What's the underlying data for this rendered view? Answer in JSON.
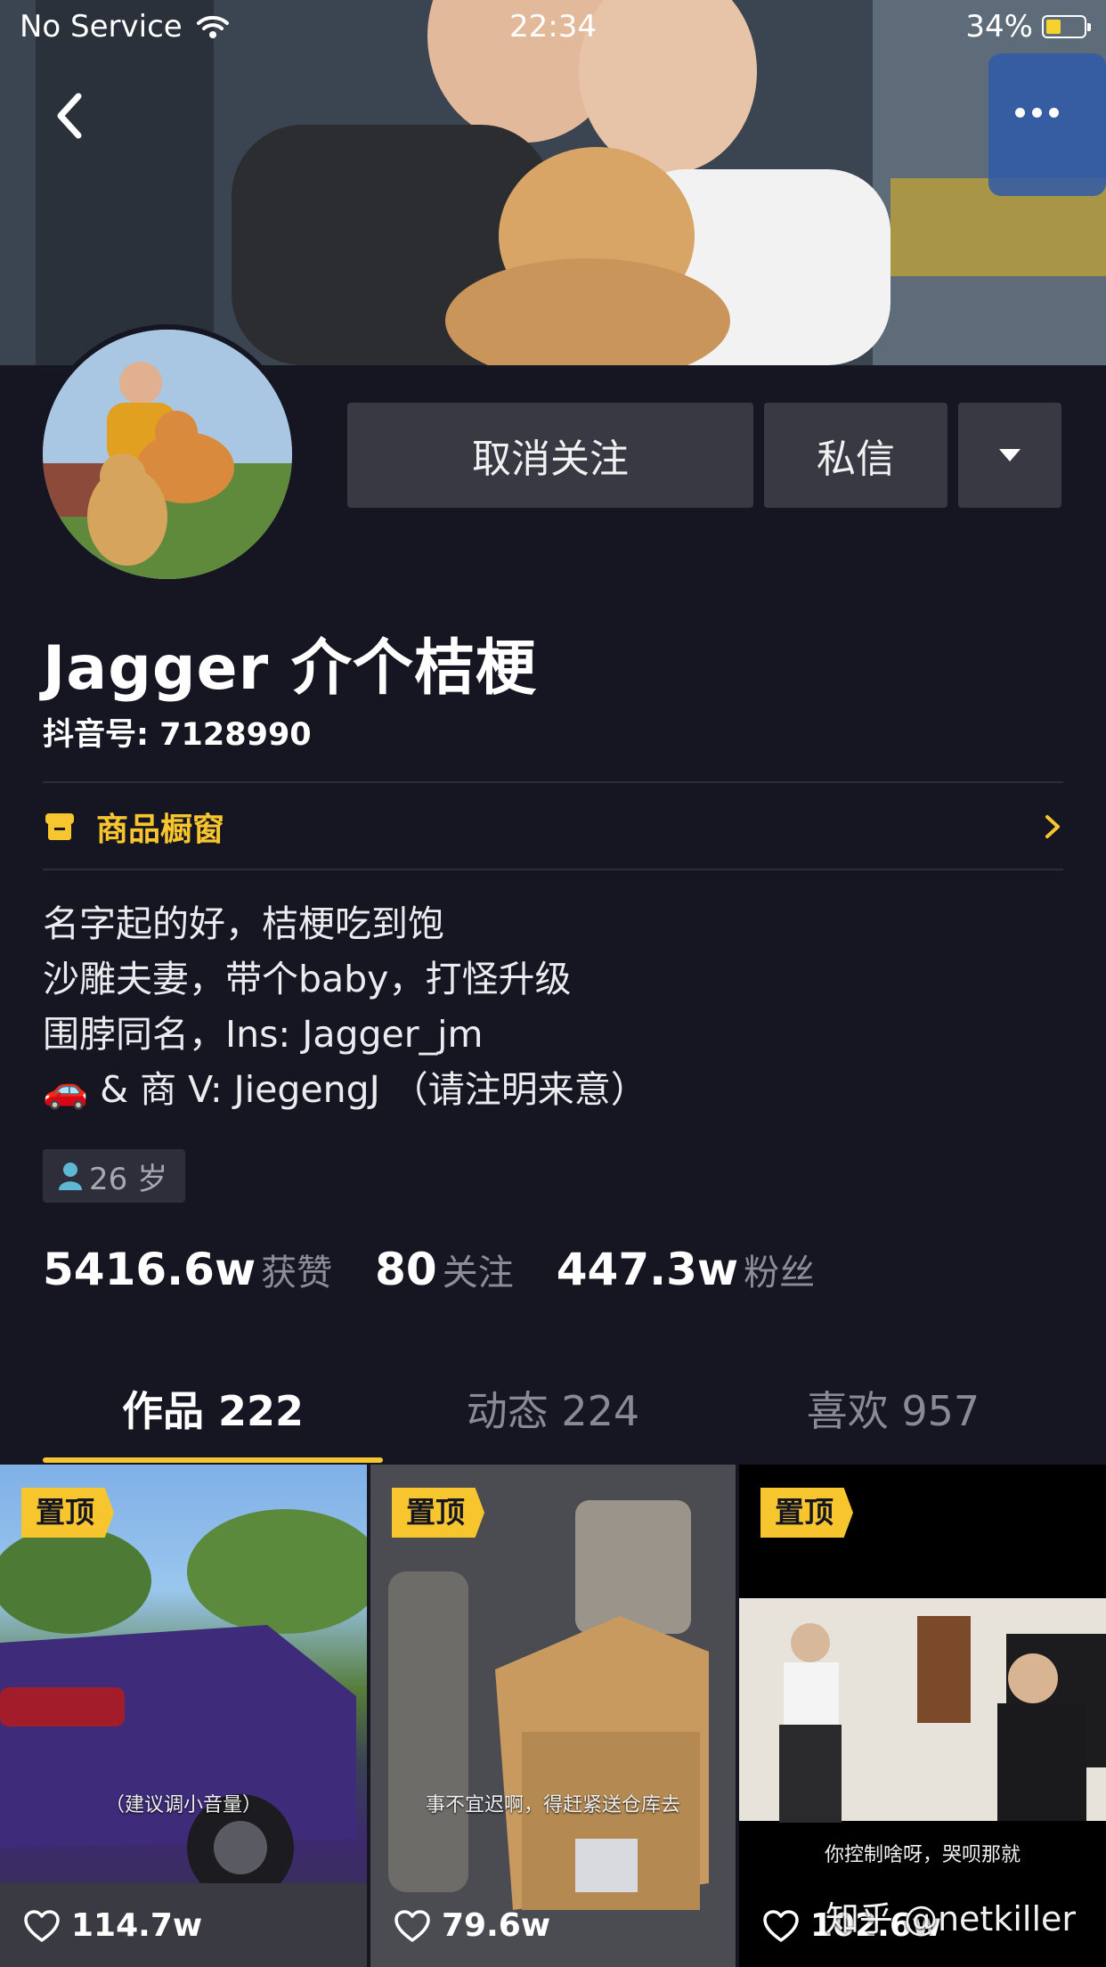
{
  "status_bar": {
    "carrier": "No Service",
    "time": "22:34",
    "battery": "34%",
    "battery_level": 0.34
  },
  "profile": {
    "name": "Jagger 介个桔梗",
    "douyin_id": "抖音号: 7128990",
    "shop_label": "商品橱窗",
    "bio": [
      "名字起的好，桔梗吃到饱",
      "沙雕夫妻，带个baby，打怪升级",
      "围脖同名，Ins: Jagger_jm",
      "🚗 & 商 V: JiegengJ （请注明来意）"
    ],
    "age": "26 岁"
  },
  "actions": {
    "unfollow": "取消关注",
    "message": "私信"
  },
  "stats": [
    {
      "value": "5416.6w",
      "label": "获赞"
    },
    {
      "value": "80",
      "label": "关注"
    },
    {
      "value": "447.3w",
      "label": "粉丝"
    }
  ],
  "tabs": [
    {
      "label": "作品 222",
      "active": true
    },
    {
      "label": "动态 224",
      "active": false
    },
    {
      "label": "喜欢 957",
      "active": false
    }
  ],
  "videos": [
    {
      "pinned_label": "置顶",
      "caption": "（建议调小音量）",
      "likes": "114.7w"
    },
    {
      "pinned_label": "置顶",
      "caption": "事不宜迟啊，得赶紧送仓库去",
      "likes": "79.6w"
    },
    {
      "pinned_label": "置顶",
      "caption": "你控制啥呀，哭呗那就",
      "likes": "102.6w"
    }
  ],
  "watermark": "知乎 @netkiller",
  "colors": {
    "background": "#161623",
    "accent": "#f7c62f",
    "button": "#393944"
  }
}
